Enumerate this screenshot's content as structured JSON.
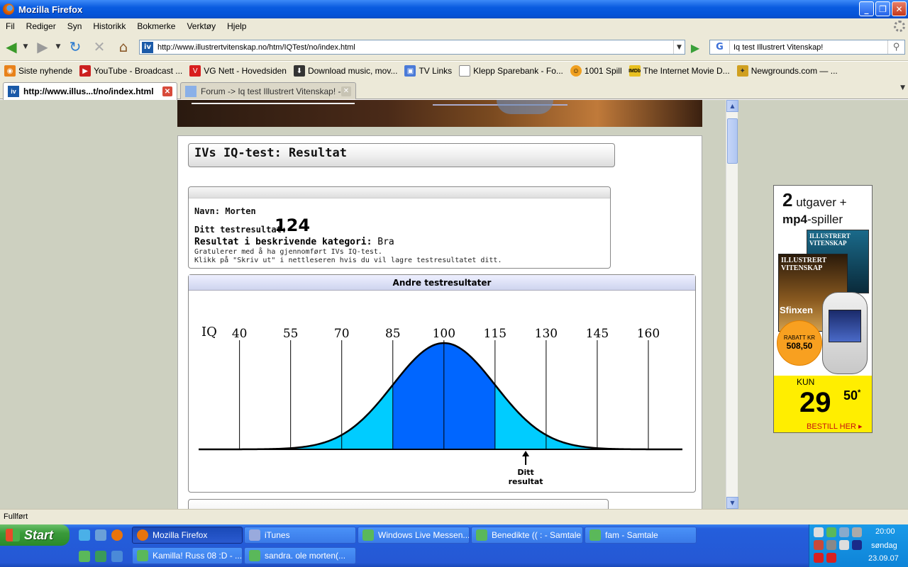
{
  "window": {
    "title": "Mozilla Firefox",
    "controls": {
      "minimize": "_",
      "maximize": "❐",
      "close": "✕"
    }
  },
  "menu": [
    "Fil",
    "Rediger",
    "Syn",
    "Historikk",
    "Bokmerke",
    "Verktøy",
    "Hjelp"
  ],
  "nav": {
    "url": "http://www.illustrertvitenskap.no/htm/IQTest/no/index.html",
    "search_query": "Iq test Illustrert Vitenskap!",
    "search_engine": "Google"
  },
  "bookmarks": [
    {
      "label": "Siste nyhende",
      "icon": "rss-icon",
      "color": "#e8821a"
    },
    {
      "label": "YouTube - Broadcast ...",
      "icon": "youtube-icon",
      "color": "#cc2020"
    },
    {
      "label": "VG Nett - Hovedsiden",
      "icon": "vg-icon",
      "color": "#d81e1e"
    },
    {
      "label": "Download music, mov...",
      "icon": "download-icon",
      "color": "#333333"
    },
    {
      "label": "TV Links",
      "icon": "tv-icon",
      "color": "#4a7ad8"
    },
    {
      "label": "Klepp Sparebank - Fo...",
      "icon": "page-icon",
      "color": "#ffffff"
    },
    {
      "label": "1001 Spill",
      "icon": "smiley-icon",
      "color": "#f0a020"
    },
    {
      "label": "The Internet Movie D...",
      "icon": "imdb-icon",
      "color": "#e8c020"
    },
    {
      "label": "Newgrounds.com — ...",
      "icon": "newgrounds-icon",
      "color": "#d0a020"
    }
  ],
  "tabs": [
    {
      "label": "http://www.illus...t/no/index.html",
      "active": true
    },
    {
      "label": "Forum -> Iq test Illustrert Vitenskap! -...",
      "active": false
    }
  ],
  "page": {
    "title": "IVs IQ-test: Resultat",
    "name_label": "Navn:",
    "name_value": "Morten",
    "score_label": "Ditt testresultat:",
    "score_value": "124",
    "category_label": "Resultat i beskrivende kategori:",
    "category_value": "Bra",
    "message1": "Gratulerer med å ha gjennomført IVs IQ-test.",
    "message2": "Klikk på \"Skriv ut\" i nettleseren hvis du vil lagre testresultatet ditt.",
    "other_results_header": "Andre testresultater",
    "result_marker_line1": "Ditt",
    "result_marker_line2": "resultat"
  },
  "chart_data": {
    "type": "area",
    "xlabel": "IQ",
    "ticks": [
      40,
      55,
      70,
      85,
      100,
      115,
      130,
      145,
      160
    ],
    "mean": 100,
    "sd": 15,
    "xlim": [
      28,
      170
    ],
    "bands": [
      {
        "from": 70,
        "to": 85,
        "color": "#00ccff"
      },
      {
        "from": 85,
        "to": 115,
        "color": "#0066ff"
      },
      {
        "from": 115,
        "to": 130,
        "color": "#00ccff"
      }
    ],
    "marker": 124
  },
  "ad": {
    "line1_num": "2",
    "line1_text": "utgaver +",
    "line2_bold": "mp4",
    "line2_text": "-spiller",
    "mag1": "ILLUSTRERT VITENSKAP",
    "mag2": "ILLUSTRERT VITENSKAP",
    "mag2_sub": "Sfinxen",
    "rabatt_label": "RABATT KR",
    "rabatt_value": "508,50",
    "kun": "KUN",
    "price": "29",
    "cents": "50",
    "star": "*",
    "cta": "BESTILL HER ▸"
  },
  "status": "Fullført",
  "taskbar": {
    "start": "Start",
    "row1": [
      {
        "label": "Mozilla Firefox",
        "active": true
      },
      {
        "label": "iTunes",
        "active": false
      },
      {
        "label": "Windows Live Messen...",
        "active": false
      },
      {
        "label": "Benedikte (( : - Samtale",
        "active": false
      },
      {
        "label": "fam - Samtale",
        "active": false
      }
    ],
    "row2": [
      {
        "label": "Kamilla!  Russ 08 :D - ...",
        "active": false
      },
      {
        "label": "sandra.   ole morten(...",
        "active": false
      }
    ],
    "clock": {
      "time": "20:00",
      "day": "søndag",
      "date": "23.09.07"
    }
  }
}
